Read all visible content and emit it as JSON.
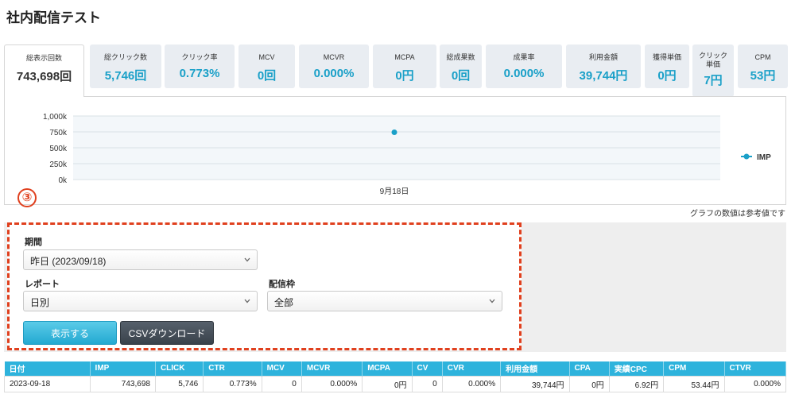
{
  "page_title": "社内配信テスト",
  "tabs": [
    {
      "label": "総表示回数",
      "value": "743,698回"
    },
    {
      "label": "総クリック数",
      "value": "5,746回"
    },
    {
      "label": "クリック率",
      "value": "0.773%"
    },
    {
      "label": "MCV",
      "value": "0回"
    },
    {
      "label": "MCVR",
      "value": "0.000%"
    },
    {
      "label": "MCPA",
      "value": "0円"
    },
    {
      "label": "総成果数",
      "value": "0回"
    },
    {
      "label": "成果率",
      "value": "0.000%"
    },
    {
      "label": "利用金額",
      "value": "39,744円"
    },
    {
      "label": "獲得単価",
      "value": "0円"
    },
    {
      "label": "クリック単価",
      "value": "7円"
    },
    {
      "label": "CPM",
      "value": "53円"
    }
  ],
  "chart_data": {
    "type": "line",
    "x": [
      "9月18日"
    ],
    "series": [
      {
        "name": "IMP",
        "values": [
          743698
        ]
      }
    ],
    "y_ticks": [
      "1,000k",
      "750k",
      "500k",
      "250k",
      "0k"
    ],
    "ylim": [
      0,
      1000000
    ],
    "grid": true,
    "legend_position": "right",
    "series_color": "#1aa0c8"
  },
  "chart_note": "グラフの数値は参考値です",
  "annotation_number": "③",
  "filters": {
    "period_label": "期間",
    "period_value": "昨日 (2023/09/18)",
    "report_label": "レポート",
    "report_value": "日別",
    "slot_label": "配信枠",
    "slot_value": "全部",
    "show_button": "表示する",
    "csv_button": "CSVダウンロード"
  },
  "table": {
    "headers": [
      "日付",
      "IMP",
      "CLICK",
      "CTR",
      "MCV",
      "MCVR",
      "MCPA",
      "CV",
      "CVR",
      "利用金額",
      "CPA",
      "実績CPC",
      "CPM",
      "CTVR"
    ],
    "rows": [
      [
        "2023-09-18",
        "743,698",
        "5,746",
        "0.773%",
        "0",
        "0.000%",
        "0円",
        "0",
        "0.000%",
        "39,744円",
        "0円",
        "6.92円",
        "53.44円",
        "0.000%"
      ]
    ]
  }
}
